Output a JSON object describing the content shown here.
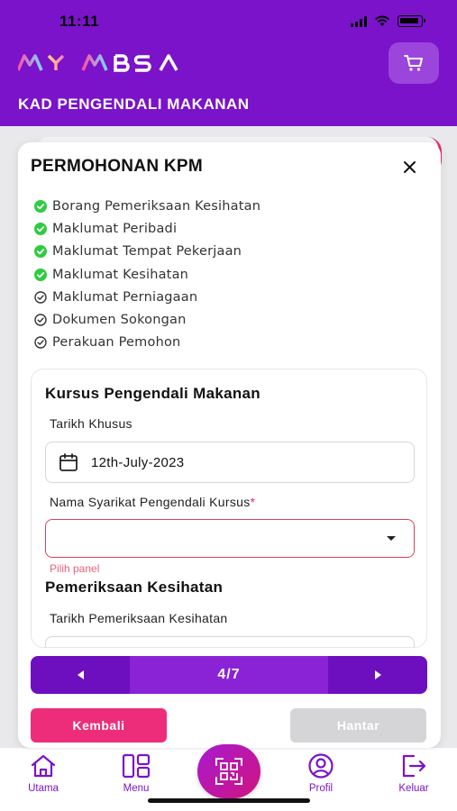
{
  "status_bar": {
    "time": "11:11"
  },
  "header": {
    "logo_text": "MY MBSA",
    "page_title": "KAD PENGENDALI MAKANAN",
    "cart_icon": "cart-icon"
  },
  "modal": {
    "title": "PERMOHONAN KPM",
    "close_icon": "close-icon",
    "steps": [
      {
        "label": "Borang Pemeriksaan Kesihatan",
        "status": "done"
      },
      {
        "label": "Maklumat Peribadi",
        "status": "done"
      },
      {
        "label": "Maklumat Tempat Pekerjaan",
        "status": "done"
      },
      {
        "label": "Maklumat Kesihatan",
        "status": "done"
      },
      {
        "label": "Maklumat Perniagaan",
        "status": "pending"
      },
      {
        "label": "Dokumen Sokongan",
        "status": "pending"
      },
      {
        "label": "Perakuan Pemohon",
        "status": "pending"
      }
    ],
    "form": {
      "section1_title": "Kursus Pengendali Makanan",
      "date_label": "Tarikh Khusus",
      "date_value": "12th-July-2023",
      "company_label": "Nama Syarikat Pengendali Kursus",
      "company_required_mark": "*",
      "company_value": "",
      "company_error": "Pilih panel",
      "section2_title": "Pemeriksaan Kesihatan",
      "health_date_label": "Tarikh Pemeriksaan Kesihatan"
    },
    "pager": {
      "text": "4/7"
    },
    "back_label": "Kembali",
    "submit_label": "Hantar"
  },
  "colors": {
    "primary": "#7a13c9",
    "accent_pink": "#ee2d7a",
    "success_green": "#2ecc40",
    "disabled_gray": "#d5d5d8"
  },
  "bottom_nav": [
    {
      "label": "Utama",
      "icon": "home-icon"
    },
    {
      "label": "Menu",
      "icon": "menu-grid-icon"
    },
    {
      "label": "",
      "icon": "qr-code-icon"
    },
    {
      "label": "Profil",
      "icon": "profile-icon"
    },
    {
      "label": "Keluar",
      "icon": "logout-icon"
    }
  ]
}
